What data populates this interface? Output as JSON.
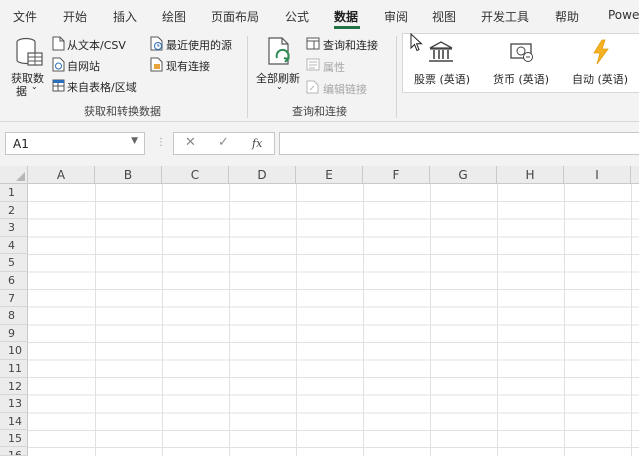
{
  "ribbon_tabs": [
    "文件",
    "开始",
    "插入",
    "绘图",
    "页面布局",
    "公式",
    "数据",
    "审阅",
    "视图",
    "开发工具",
    "帮助",
    "Powe"
  ],
  "active_tab": "数据",
  "get_transform": {
    "get_data_line1": "获取数",
    "get_data_line2": "据",
    "from_text_csv": "从文本/CSV",
    "from_web": "自网站",
    "from_table": "来自表格/区域",
    "recent_sources": "最近使用的源",
    "existing_connections": "现有连接",
    "group_label": "获取和转换数据"
  },
  "queries_connections": {
    "refresh_all": "全部刷新",
    "queries_and_connections": "查询和连接",
    "properties": "属性",
    "edit_links": "编辑链接",
    "group_label": "查询和连接"
  },
  "data_types": {
    "stocks": "股票 (英语)",
    "currencies": "货币 (英语)",
    "automatic": "自动 (英语)"
  },
  "formula_bar": {
    "name_box": "A1",
    "cancel_symbol": "✕",
    "enter_symbol": "✓",
    "fx_symbol": "fx",
    "formula": ""
  },
  "columns": [
    "A",
    "B",
    "C",
    "D",
    "E",
    "F",
    "G",
    "H",
    "I"
  ],
  "rows": [
    "1",
    "2",
    "3",
    "4",
    "5",
    "6",
    "7",
    "8",
    "9",
    "10",
    "11",
    "12",
    "13",
    "14",
    "15",
    "16"
  ],
  "colors": {
    "accent": "#217346",
    "ribbon_bg": "#f3f3f3",
    "gridline": "#e1e1e1"
  },
  "icons": [
    "database-icon",
    "text-file-icon",
    "web-icon",
    "table-icon",
    "recent-source-icon",
    "existing-connection-icon",
    "refresh-icon",
    "query-pane-icon",
    "properties-icon",
    "edit-links-icon",
    "bank-icon",
    "currency-icon",
    "lightning-icon",
    "mouse-pointer-icon"
  ]
}
